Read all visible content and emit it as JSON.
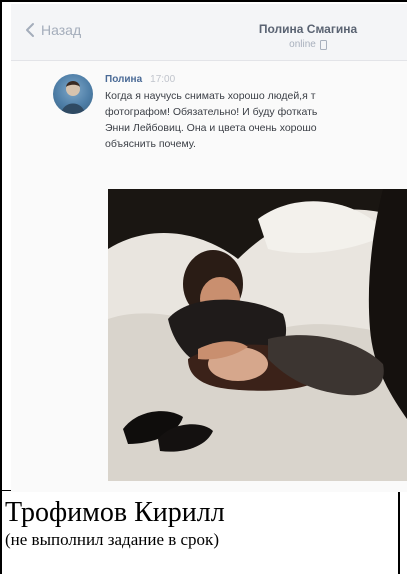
{
  "chat": {
    "back_label": "Назад",
    "contact_name": "Полина Смагина",
    "contact_status": "online"
  },
  "message": {
    "author": "Полина",
    "time": "17:00",
    "lines": [
      "Когда я научусь снимать хорошо людей,я т",
      "фотографом! Обязательно! И буду фоткать",
      "Энни Лейбовиц. Она и цвета очень хорошо",
      "объяснить почему."
    ]
  },
  "caption": {
    "name": "Трофимов Кирилл",
    "note": "(не выполнил задание в срок)"
  }
}
